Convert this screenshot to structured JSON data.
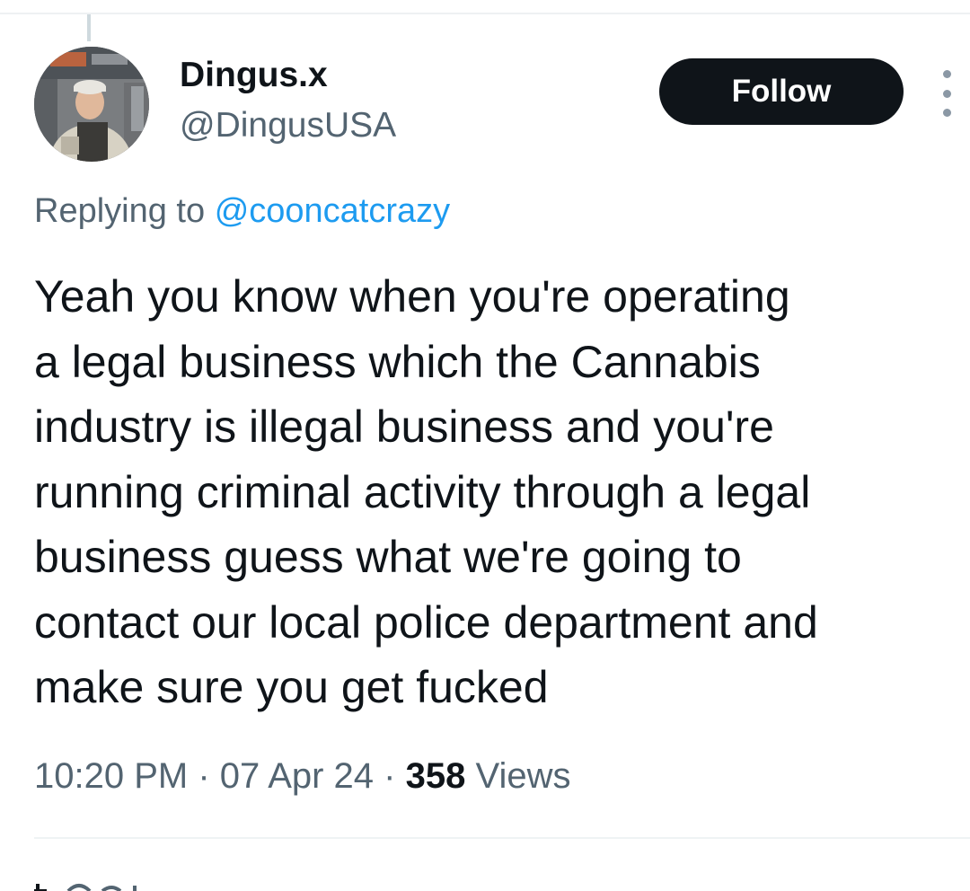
{
  "tweet": {
    "author": {
      "display_name": "Dingus.x",
      "handle": "@DingusUSA"
    },
    "follow_label": "Follow",
    "reply": {
      "prefix": "Replying to",
      "to_handle": "@cooncatcrazy"
    },
    "text_lines": [
      "Yeah you know when you're operating",
      "a legal business which the Cannabis",
      "industry is illegal business and you're",
      "running criminal activity through a legal",
      "business guess what we're going to",
      "contact our local police department and",
      "make sure you get fucked"
    ],
    "meta": {
      "time": "10:20 PM",
      "separator": "·",
      "date": "07 Apr 24",
      "views_count": "358",
      "views_label": "Views"
    }
  },
  "icons": {
    "more": "more-vertical-icon"
  },
  "colors": {
    "text_primary": "#0f1419",
    "text_secondary": "#536471",
    "link": "#1d9bf0",
    "follow_bg": "#0f1419",
    "follow_text": "#ffffff",
    "divider": "#eff3f4"
  }
}
